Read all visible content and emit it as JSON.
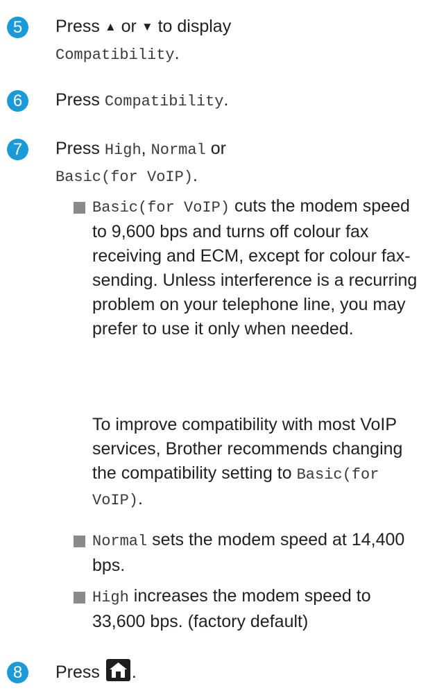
{
  "steps": [
    {
      "number": "5",
      "pre": "Press ",
      "up": "▲",
      "or": " or ",
      "down": "▼",
      "post": " to display",
      "mono": "Compatibility",
      "end": "."
    },
    {
      "number": "6",
      "pre": "Press ",
      "mono": "Compatibility",
      "end": "."
    },
    {
      "number": "7",
      "pre": "Press ",
      "mono1": "High",
      "sep1": ", ",
      "mono2": "Normal",
      "sep2": " or",
      "mono3": "Basic(for VoIP)",
      "end": "."
    },
    {
      "number": "8",
      "pre": "Press ",
      "icon": "home-icon",
      "end": "."
    }
  ],
  "bullets": [
    {
      "mono": "Basic(for VoIP)",
      "text": " cuts the modem speed to 9,600 bps and turns off colour fax receiving and ECM, except for colour fax-sending. Unless interference is a recurring problem on your telephone line, you may prefer to use it only when needed."
    },
    {
      "mono": "Normal",
      "text": " sets the modem speed at 14,400 bps."
    },
    {
      "mono": "High",
      "text": " increases the modem speed to 33,600 bps. (factory default)"
    }
  ],
  "note": {
    "text": "To improve compatibility with most VoIP services, Brother recommends changing the compatibility setting to ",
    "mono": "Basic(for VoIP)",
    "end": "."
  },
  "colors": {
    "step_circle": "#1a9ad6",
    "bullet": "#8a8a8a",
    "text": "#231f20"
  }
}
